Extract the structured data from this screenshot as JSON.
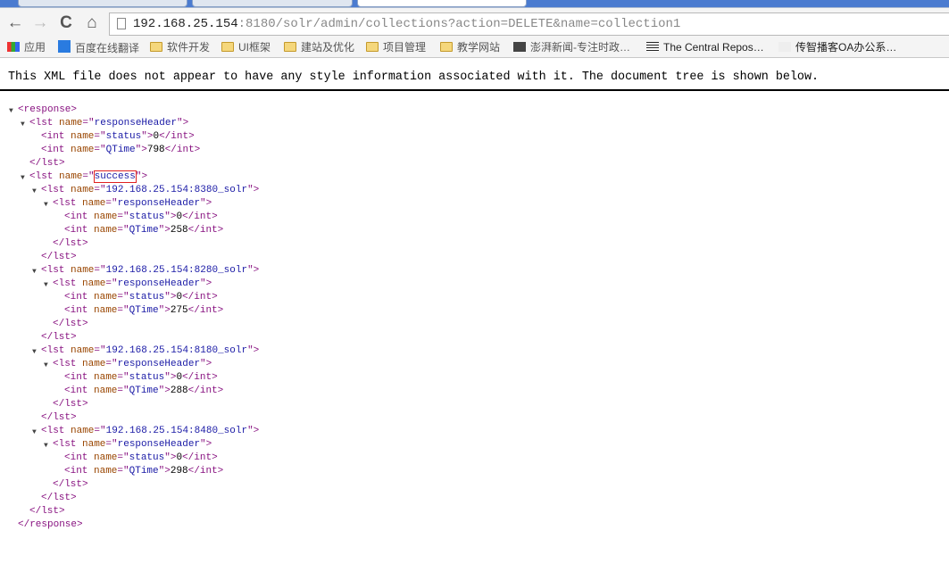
{
  "browser": {
    "tabs": [
      {
        "title": ""
      },
      {
        "title": "solr"
      },
      {
        "title": ""
      }
    ],
    "nav": {
      "back": "←",
      "forward": "→",
      "reload": "C",
      "home": "⌂"
    },
    "url": {
      "host": "192.168.25.154",
      "rest": ":8180/solr/admin/collections?action=DELETE&name=collection1"
    },
    "bookmarks": [
      {
        "label": "应用",
        "icon": "apps-grid-icon"
      },
      {
        "label": "百度在线翻译",
        "icon": "translate-icon"
      },
      {
        "label": "软件开发",
        "icon": "folder-icon"
      },
      {
        "label": "UI框架",
        "icon": "folder-icon"
      },
      {
        "label": "建站及优化",
        "icon": "folder-icon"
      },
      {
        "label": "项目管理",
        "icon": "folder-icon"
      },
      {
        "label": "教学网站",
        "icon": "folder-icon"
      },
      {
        "label": "澎湃新闻-专注时政…",
        "icon": "thepaper-icon"
      },
      {
        "label": "The Central Repos…",
        "icon": "list-icon"
      },
      {
        "label": "传智播客OA办公系…",
        "icon": "abvs-icon"
      }
    ]
  },
  "page": {
    "info": "This XML file does not appear to have any style information associated with it. The document tree is shown below.",
    "highlighted": "success",
    "tree": {
      "tag": "response",
      "children": [
        {
          "tag": "lst",
          "name": "responseHeader",
          "children": [
            {
              "tag": "int",
              "name": "status",
              "value": "0"
            },
            {
              "tag": "int",
              "name": "QTime",
              "value": "798"
            }
          ]
        },
        {
          "tag": "lst",
          "name": "success",
          "children": [
            {
              "tag": "lst",
              "name": "192.168.25.154:8380_solr",
              "children": [
                {
                  "tag": "lst",
                  "name": "responseHeader",
                  "children": [
                    {
                      "tag": "int",
                      "name": "status",
                      "value": "0"
                    },
                    {
                      "tag": "int",
                      "name": "QTime",
                      "value": "258"
                    }
                  ]
                }
              ]
            },
            {
              "tag": "lst",
              "name": "192.168.25.154:8280_solr",
              "children": [
                {
                  "tag": "lst",
                  "name": "responseHeader",
                  "children": [
                    {
                      "tag": "int",
                      "name": "status",
                      "value": "0"
                    },
                    {
                      "tag": "int",
                      "name": "QTime",
                      "value": "275"
                    }
                  ]
                }
              ]
            },
            {
              "tag": "lst",
              "name": "192.168.25.154:8180_solr",
              "children": [
                {
                  "tag": "lst",
                  "name": "responseHeader",
                  "children": [
                    {
                      "tag": "int",
                      "name": "status",
                      "value": "0"
                    },
                    {
                      "tag": "int",
                      "name": "QTime",
                      "value": "288"
                    }
                  ]
                }
              ]
            },
            {
              "tag": "lst",
              "name": "192.168.25.154:8480_solr",
              "children": [
                {
                  "tag": "lst",
                  "name": "responseHeader",
                  "children": [
                    {
                      "tag": "int",
                      "name": "status",
                      "value": "0"
                    },
                    {
                      "tag": "int",
                      "name": "QTime",
                      "value": "298"
                    }
                  ]
                }
              ]
            }
          ]
        }
      ]
    }
  }
}
